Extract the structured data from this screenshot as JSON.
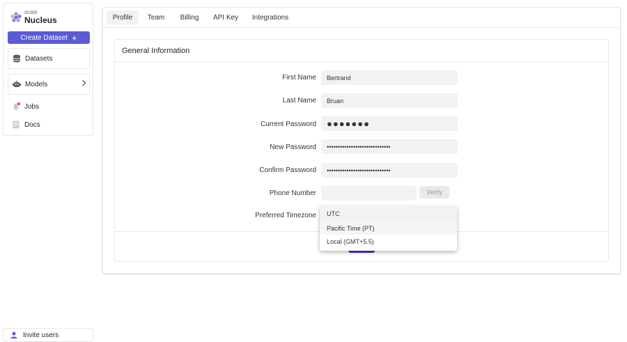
{
  "brand": {
    "small": "scale",
    "big": "Nucleus"
  },
  "sidebar": {
    "create_label": "Create Dataset",
    "items": [
      {
        "label": "Datasets",
        "icon": "database-icon"
      },
      {
        "label": "Models",
        "icon": "robot-icon"
      },
      {
        "label": "Jobs",
        "icon": "bell-icon"
      },
      {
        "label": "Docs",
        "icon": "document-icon"
      }
    ],
    "invite_label": "Invite users"
  },
  "tabs": [
    {
      "label": "Profile",
      "active": true
    },
    {
      "label": "Team"
    },
    {
      "label": "Billing"
    },
    {
      "label": "API Key"
    },
    {
      "label": "Integrations"
    }
  ],
  "form": {
    "title": "General Information",
    "first_name": {
      "label": "First Name",
      "value": "Bertrand"
    },
    "last_name": {
      "label": "Last Name",
      "value": "Bruan"
    },
    "current_password": {
      "label": "Current Password",
      "value": "●●●●●●●"
    },
    "new_password": {
      "label": "New Password",
      "value": "•••••••••••••••••••••••••••••"
    },
    "confirm_password": {
      "label": "Confirm Password",
      "value": "•••••••••••••••••••••••••••••"
    },
    "phone": {
      "label": "Phone Number",
      "value": "",
      "verify_label": "Verify"
    },
    "timezone": {
      "label": "Preferred Timezone",
      "options": [
        "UTC",
        "Pacific Time (PT)",
        "Local (GMT+5.5)"
      ]
    }
  },
  "colors": {
    "accent": "#5b5bd6",
    "notification": "#e5484d"
  }
}
